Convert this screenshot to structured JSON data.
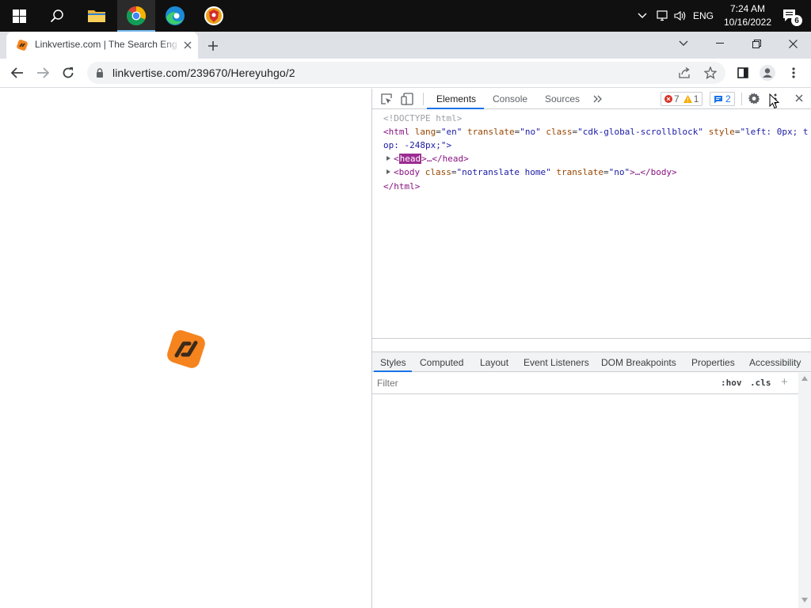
{
  "taskbar": {
    "language": "ENG",
    "time": "7:24 AM",
    "date": "10/16/2022",
    "notification_count": "6"
  },
  "browser": {
    "tab_title": "Linkvertise.com | The Search Engine",
    "url": "linkvertise.com/239670/Hereyuhgo/2"
  },
  "devtools": {
    "tabs": [
      "Elements",
      "Console",
      "Sources"
    ],
    "error_count": "7",
    "warning_count": "1",
    "message_count": "2",
    "dom": {
      "doctype": "<!DOCTYPE html>",
      "html_open_tag": "<html",
      "html_attrs": [
        {
          "name": "lang",
          "value": "\"en\""
        },
        {
          "name": "translate",
          "value": "\"no\""
        },
        {
          "name": "class",
          "value": "\"cdk-global-scrollblock\""
        },
        {
          "name": "style",
          "value": "\"left: 0px; t"
        }
      ],
      "html_wrap": "op: -248px;\">",
      "head_open": "<",
      "head_name": "head",
      "head_rest": ">…</head>",
      "body_open": "<body",
      "body_attrs": [
        {
          "name": "class",
          "value": "\"notranslate home\""
        },
        {
          "name": "translate",
          "value": "\"no\""
        }
      ],
      "body_rest": ">…</body>",
      "html_close": "</html>"
    },
    "styles_tabs": [
      "Styles",
      "Computed",
      "Layout",
      "Event Listeners",
      "DOM Breakpoints",
      "Properties",
      "Accessibility"
    ],
    "filter_placeholder": "Filter",
    "hov_label": ":hov",
    "cls_label": ".cls",
    "plus_label": "+"
  },
  "colors": {
    "taskbar_bg": "#101010",
    "tabstrip_bg": "#dee1e6",
    "accent_blue": "#1a73e8",
    "loader_orange": "#f5841f"
  }
}
